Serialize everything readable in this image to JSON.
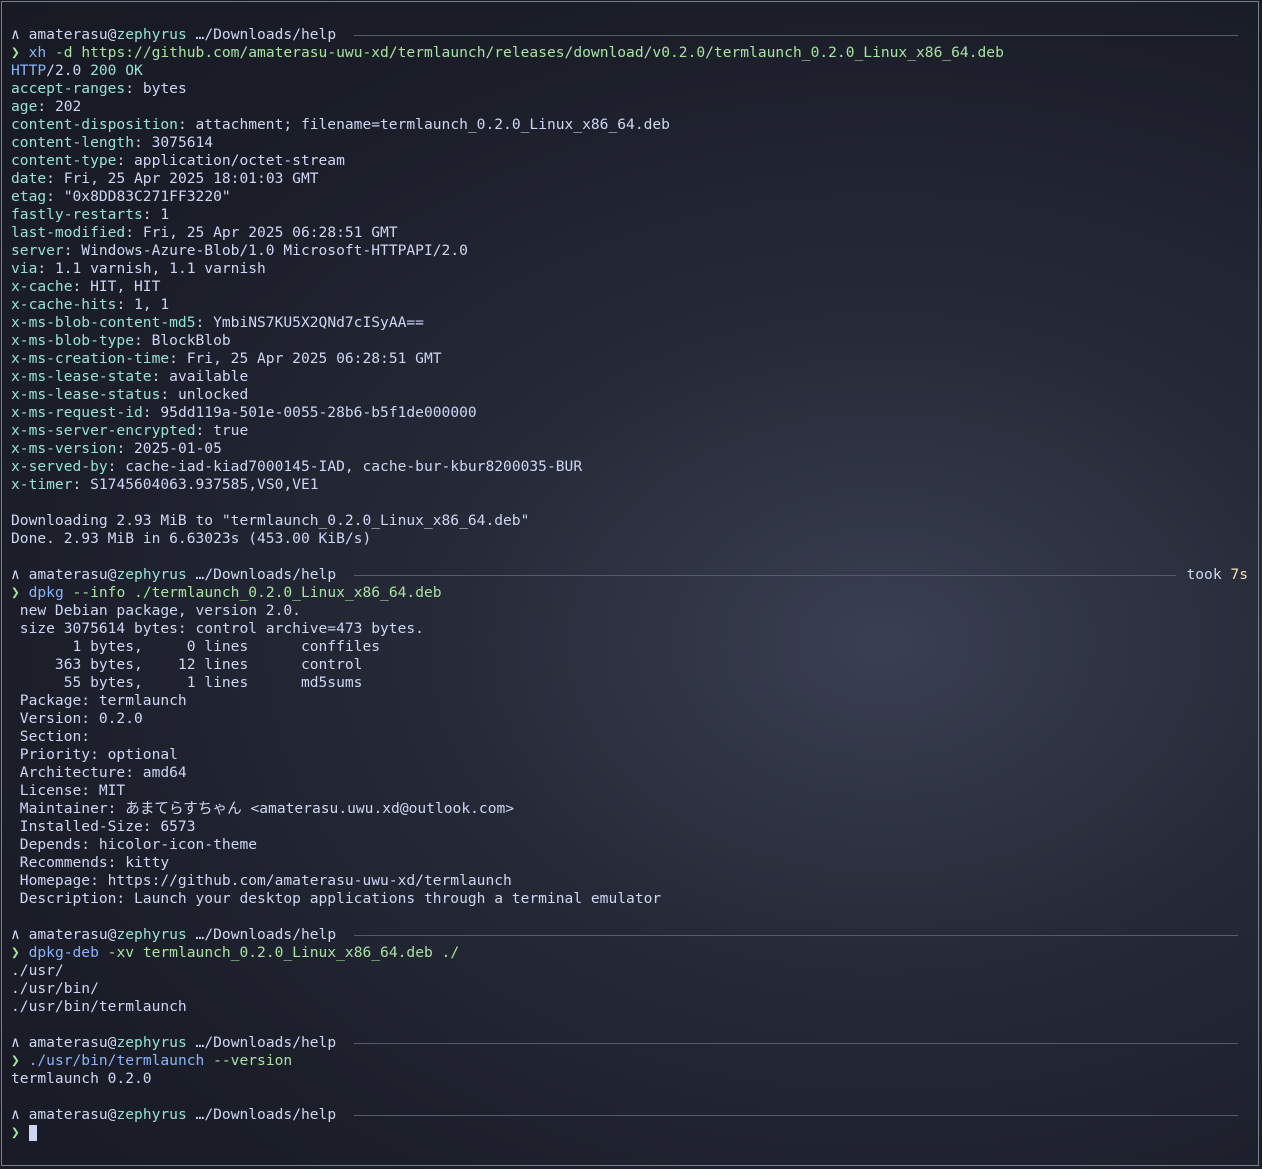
{
  "prompt": {
    "marker": "∧",
    "user": "amaterasu",
    "at": "@",
    "host": "zephyrus",
    "dir": " …/Downloads/help",
    "arrow": "❯"
  },
  "cmd1": {
    "bin": "xh",
    "args": " -d https://github.com/amaterasu-uwu-xd/termlaunch/releases/download/v0.2.0/termlaunch_0.2.0_Linux_x86_64.deb"
  },
  "status": {
    "proto": "HTTP",
    "ver": "/2.0",
    "code": " 200 OK"
  },
  "headers": [
    {
      "k": "accept-ranges",
      "v": "bytes"
    },
    {
      "k": "age",
      "v": "202"
    },
    {
      "k": "content-disposition",
      "v": "attachment; filename=termlaunch_0.2.0_Linux_x86_64.deb"
    },
    {
      "k": "content-length",
      "v": "3075614"
    },
    {
      "k": "content-type",
      "v": "application/octet-stream"
    },
    {
      "k": "date",
      "v": "Fri, 25 Apr 2025 18:01:03 GMT"
    },
    {
      "k": "etag",
      "v": "\"0x8DD83C271FF3220\""
    },
    {
      "k": "fastly-restarts",
      "v": "1"
    },
    {
      "k": "last-modified",
      "v": "Fri, 25 Apr 2025 06:28:51 GMT"
    },
    {
      "k": "server",
      "v": "Windows-Azure-Blob/1.0 Microsoft-HTTPAPI/2.0"
    },
    {
      "k": "via",
      "v": "1.1 varnish, 1.1 varnish"
    },
    {
      "k": "x-cache",
      "v": "HIT, HIT"
    },
    {
      "k": "x-cache-hits",
      "v": "1, 1"
    },
    {
      "k": "x-ms-blob-content-md5",
      "v": "YmbiNS7KU5X2QNd7cISyAA=="
    },
    {
      "k": "x-ms-blob-type",
      "v": "BlockBlob"
    },
    {
      "k": "x-ms-creation-time",
      "v": "Fri, 25 Apr 2025 06:28:51 GMT"
    },
    {
      "k": "x-ms-lease-state",
      "v": "available"
    },
    {
      "k": "x-ms-lease-status",
      "v": "unlocked"
    },
    {
      "k": "x-ms-request-id",
      "v": "95dd119a-501e-0055-28b6-b5f1de000000"
    },
    {
      "k": "x-ms-server-encrypted",
      "v": "true"
    },
    {
      "k": "x-ms-version",
      "v": "2025-01-05"
    },
    {
      "k": "x-served-by",
      "v": "cache-iad-kiad7000145-IAD, cache-bur-kbur8200035-BUR"
    },
    {
      "k": "x-timer",
      "v": "S1745604063.937585,VS0,VE1"
    }
  ],
  "download": {
    "line1": "Downloading 2.93 MiB to \"termlaunch_0.2.0_Linux_x86_64.deb\"",
    "line2": "Done. 2.93 MiB in 6.63023s (453.00 KiB/s)"
  },
  "took": {
    "label": "took ",
    "value": "7s"
  },
  "cmd2": {
    "bin": "dpkg",
    "args": " --info ./termlaunch_0.2.0_Linux_x86_64.deb"
  },
  "info": [
    " new Debian package, version 2.0.",
    " size 3075614 bytes: control archive=473 bytes.",
    "       1 bytes,     0 lines      conffiles",
    "     363 bytes,    12 lines      control",
    "      55 bytes,     1 lines      md5sums",
    " Package: termlaunch",
    " Version: 0.2.0",
    " Section:",
    " Priority: optional",
    " Architecture: amd64",
    " License: MIT",
    " Maintainer: あまてらすちゃん <amaterasu.uwu.xd@outlook.com>",
    " Installed-Size: 6573",
    " Depends: hicolor-icon-theme",
    " Recommends: kitty",
    " Homepage: https://github.com/amaterasu-uwu-xd/termlaunch",
    " Description: Launch your desktop applications through a terminal emulator"
  ],
  "cmd3": {
    "bin": "dpkg-deb",
    "args": " -xv termlaunch_0.2.0_Linux_x86_64.deb ./"
  },
  "extract": [
    "./usr/",
    "./usr/bin/",
    "./usr/bin/termlaunch"
  ],
  "cmd4": {
    "bin": "./usr/bin/termlaunch",
    "args": " --version"
  },
  "version_out": "termlaunch 0.2.0"
}
